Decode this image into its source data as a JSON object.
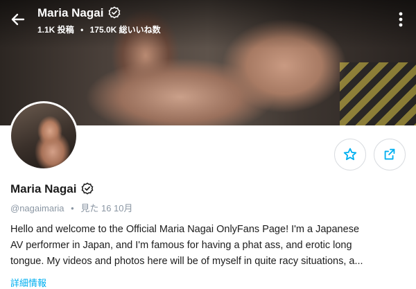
{
  "header": {
    "name": "Maria Nagai",
    "posts_count": "1.1K",
    "posts_label": "投稿",
    "likes_count": "175.0K",
    "likes_label": "総いいね数",
    "separator": "•"
  },
  "profile": {
    "name": "Maria Nagai",
    "handle": "@nagaimaria",
    "separator": "•",
    "last_seen_label": "見た",
    "last_seen_value": "16 10月",
    "bio_lines": [
      "Hello and welcome to the Official Maria Nagai OnlyFans Page! I'm a Japanese",
      "AV performer in Japan, and I'm famous for having a phat ass, and erotic long",
      "tongue. My videos and photos here will be of myself in quite racy situations, a..."
    ],
    "more_info_label": "詳細情報"
  },
  "icons": {
    "back": "arrow-left-icon",
    "more": "more-vertical-icon",
    "verified": "verified-badge-icon",
    "favorite": "star-icon",
    "share": "share-icon"
  },
  "colors": {
    "accent": "#00aff0",
    "text": "#1c1c1c",
    "muted": "#8a96a3"
  }
}
